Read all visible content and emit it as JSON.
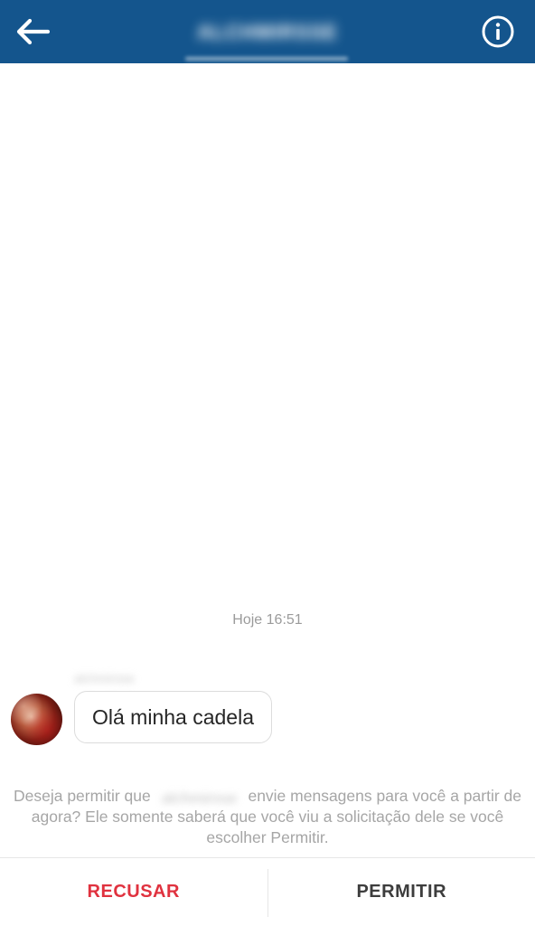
{
  "header": {
    "back_icon": "arrow-left-icon",
    "title": "ALCHMIRSSE",
    "subtitle": "",
    "info_icon": "info-circle-icon",
    "background_color": "#14558d"
  },
  "thread": {
    "timestamp": "Hoje 16:51",
    "messages": [
      {
        "sender_name": "alchmirsse",
        "avatar_icon": "profile-photo",
        "text": "Olá minha cadela"
      }
    ]
  },
  "request": {
    "text_before": "Deseja permitir que ",
    "blurred_username": "alchmirsse",
    "text_after": " envie mensagens para você a partir de agora? Ele somente saberá que você viu a solicitação dele se você escolher Permitir.",
    "decline_label": "RECUSAR",
    "allow_label": "PERMITIR",
    "decline_color": "#e0323f",
    "allow_color": "#3d3d3d"
  }
}
